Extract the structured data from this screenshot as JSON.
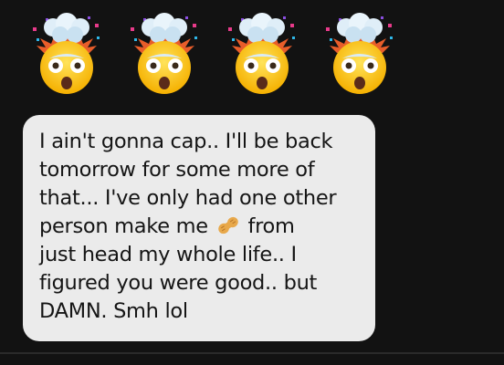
{
  "emoji_message": {
    "emojis": [
      "exploding-head-icon",
      "exploding-head-icon",
      "exploding-head-icon",
      "exploding-head-icon"
    ]
  },
  "message": {
    "line1": "I ain't gonna cap.. I'll be back",
    "line2": "tomorrow for some more of",
    "line3": "that... I've only had one other",
    "line4_before": "person make me ",
    "line4_emoji": "peanut-icon",
    "line4_after": " from",
    "line5": "just head my whole life.. I",
    "line6": "figured you were good.. but",
    "line7": "DAMN. Smh lol"
  },
  "colors": {
    "background": "#121212",
    "bubble": "#ebebeb",
    "text": "#151515"
  }
}
